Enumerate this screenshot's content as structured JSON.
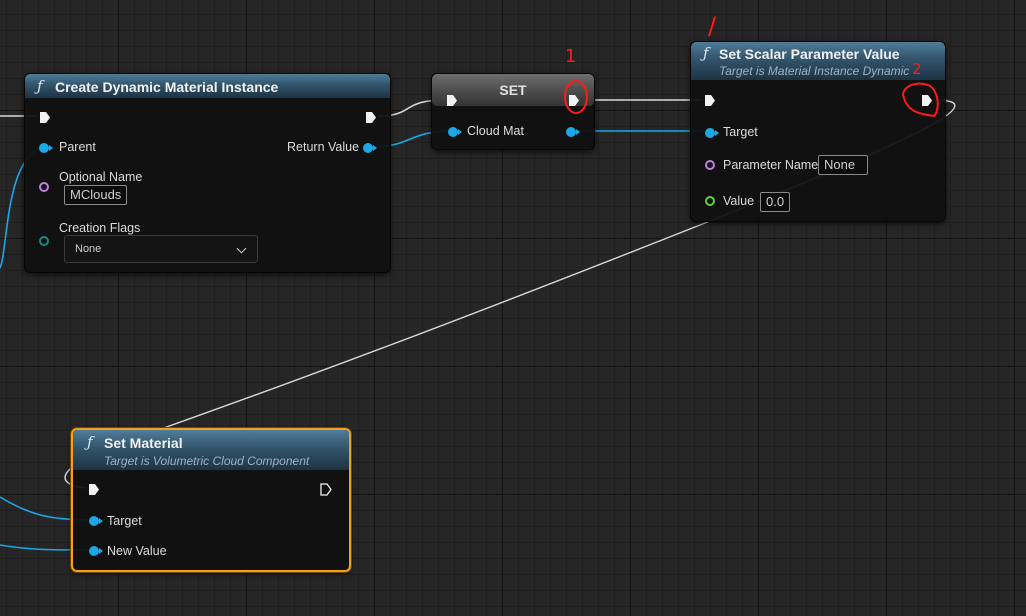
{
  "nodes": {
    "create_dmi": {
      "title": "Create Dynamic Material Instance",
      "pins": {
        "parent": "Parent",
        "optional_name": "Optional Name",
        "optional_name_value": "MClouds",
        "creation_flags": "Creation Flags",
        "creation_flags_value": "None",
        "return_value": "Return Value"
      }
    },
    "set_var": {
      "title": "SET",
      "pins": {
        "cloud_mat": "Cloud Mat"
      }
    },
    "set_scalar": {
      "title": "Set Scalar Parameter Value",
      "subtitle": "Target is Material Instance Dynamic",
      "pins": {
        "target": "Target",
        "parameter_name": "Parameter Name",
        "parameter_name_value": "None",
        "value": "Value",
        "value_value": "0.0"
      }
    },
    "set_material": {
      "title": "Set Material",
      "subtitle": "Target is Volumetric Cloud Component",
      "pins": {
        "target": "Target",
        "new_value": "New Value"
      }
    }
  },
  "annotations": {
    "mark_1": "1",
    "mark_2": "2",
    "mark_slash": "/"
  },
  "colors": {
    "exec_wire": "#d9d9d9",
    "object_pin": "#1aa8e8",
    "name_pin": "#c27fe0",
    "float_pin": "#5fd33c",
    "enum_pin": "#138a7a",
    "selection": "#f2a21a",
    "annotation": "#ff1a1a",
    "function_header": "#32546b"
  },
  "icons": {
    "function": "function-f-icon",
    "exec": "exec-arrow-icon",
    "dropdown": "chevron-down-icon"
  }
}
